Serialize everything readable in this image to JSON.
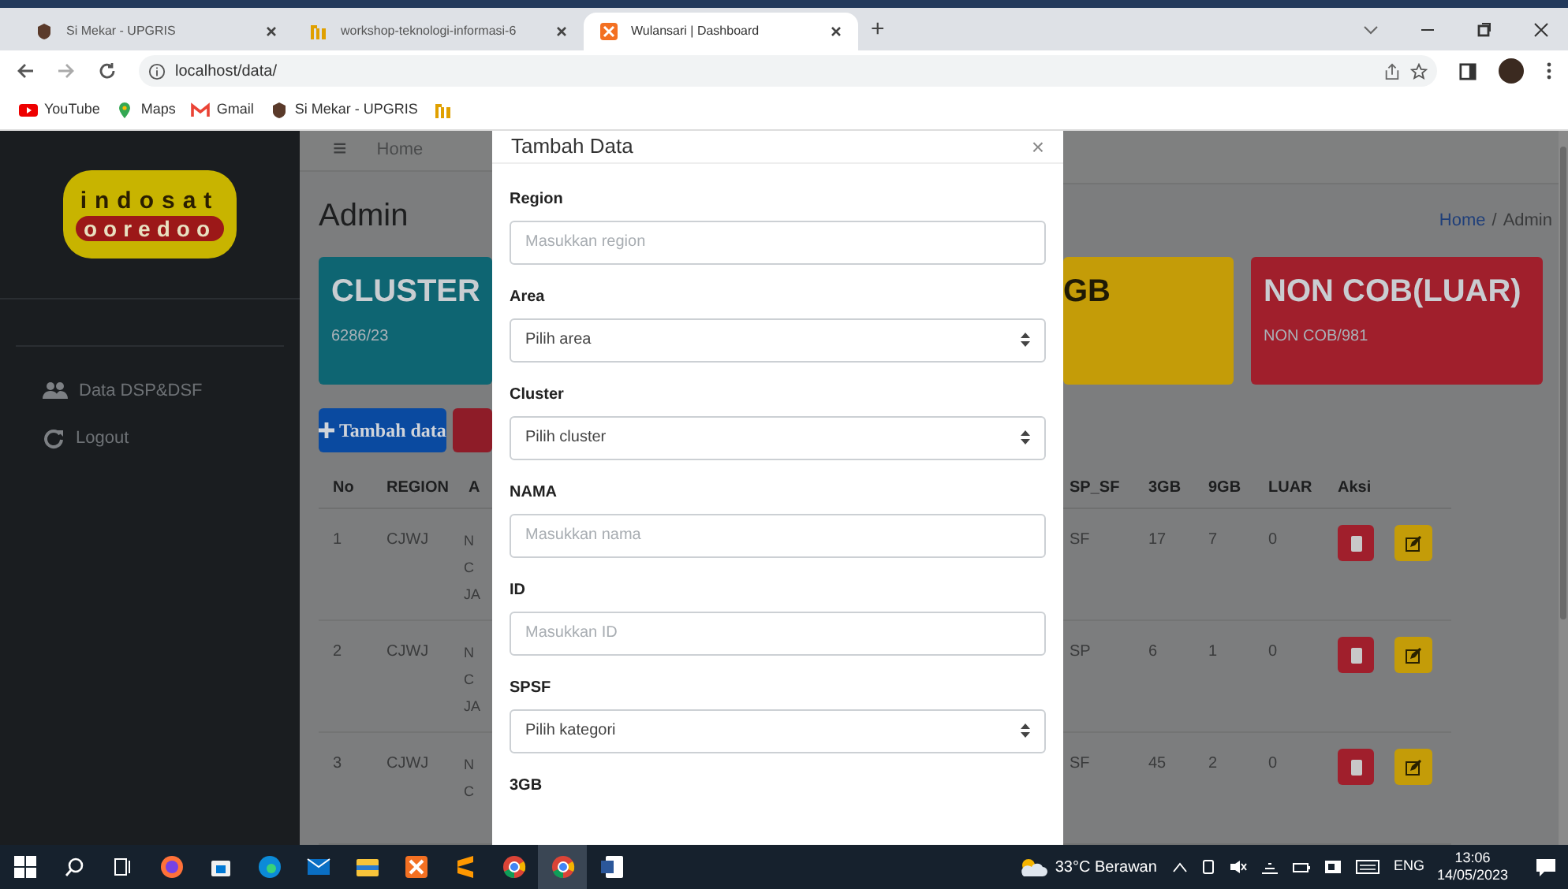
{
  "browser": {
    "tabs": [
      {
        "title": "Si Mekar - UPGRIS",
        "selected": false
      },
      {
        "title": "workshop-teknologi-informasi-6",
        "selected": false
      },
      {
        "title": "Wulansari | Dashboard",
        "selected": true
      }
    ],
    "new_tab": "+",
    "url": "localhost/data/",
    "bookmarks": [
      {
        "label": "YouTube"
      },
      {
        "label": "Maps"
      },
      {
        "label": "Gmail"
      },
      {
        "label": "Si Mekar - UPGRIS"
      }
    ]
  },
  "sidebar": {
    "logo": {
      "top": "indosat",
      "bottom": "ooredoo"
    },
    "items": [
      {
        "label": "Data DSP&DSF"
      },
      {
        "label": "Logout"
      }
    ]
  },
  "topnav": {
    "menu": "≡",
    "home": "Home"
  },
  "page_title": "Admin",
  "breadcrumb": [
    {
      "label": "Home",
      "link": true
    },
    {
      "label": "/",
      "link": false
    },
    {
      "label": "Admin",
      "link": false
    }
  ],
  "cards": [
    {
      "title": "CLUSTER",
      "subtitle": "6286/23",
      "color": "#0e6572"
    },
    {
      "title": "GB",
      "color": "#c49c08"
    },
    {
      "title": "NON COB(LUAR)",
      "subtitle": "NON COB/981",
      "color": "#a01f2c"
    }
  ],
  "add_button": "Tambah data",
  "table": {
    "columns_left": [
      "No",
      "REGION",
      "A"
    ],
    "columns_right": [
      "SP_SF",
      "3GB",
      "9GB",
      "LUAR",
      "Aksi"
    ],
    "rows": [
      {
        "no": "1",
        "region": "CJWJ",
        "column_3": [
          "N",
          "C",
          "JA"
        ],
        "sp_sf": "SF",
        "gb3": "17",
        "gb9": "7",
        "luar": "0"
      },
      {
        "no": "2",
        "region": "CJWJ",
        "column_3": [
          "N",
          "C",
          "JA"
        ],
        "sp_sf": "SP",
        "gb3": "6",
        "gb9": "1",
        "luar": "0"
      },
      {
        "no": "3",
        "region": "CJWJ",
        "column_3": [
          "N",
          "C"
        ],
        "sp_sf": "SF",
        "gb3": "45",
        "gb9": "2",
        "luar": "0"
      }
    ]
  },
  "modal": {
    "title": "Tambah Data",
    "close": "×",
    "fields": [
      {
        "label": "Region",
        "kind": "input",
        "placeholder": "Masukkan region"
      },
      {
        "label": "Area",
        "kind": "select",
        "value": "Pilih area"
      },
      {
        "label": "Cluster",
        "kind": "select",
        "value": "Pilih cluster"
      },
      {
        "label": "NAMA",
        "kind": "input",
        "placeholder": "Masukkan nama"
      },
      {
        "label": "ID",
        "kind": "input",
        "placeholder": "Masukkan ID"
      },
      {
        "label": "SPSF",
        "kind": "select",
        "value": "Pilih kategori"
      },
      {
        "label": "3GB",
        "kind": "cut"
      }
    ]
  },
  "taskbar": {
    "apps": [
      {
        "kind": "firefox",
        "selected": false
      },
      {
        "kind": "store",
        "selected": false
      },
      {
        "kind": "edge",
        "selected": false
      },
      {
        "kind": "mail",
        "selected": false
      },
      {
        "kind": "files",
        "selected": false
      },
      {
        "kind": "xampp",
        "selected": false
      },
      {
        "kind": "sublime",
        "selected": false
      },
      {
        "kind": "chrome",
        "selected": false
      },
      {
        "kind": "chrome",
        "selected": true
      },
      {
        "kind": "word",
        "selected": false
      }
    ],
    "weather": "33°C Berawan",
    "lang": "ENG",
    "time": "13:06",
    "date": "14/05/2023"
  }
}
